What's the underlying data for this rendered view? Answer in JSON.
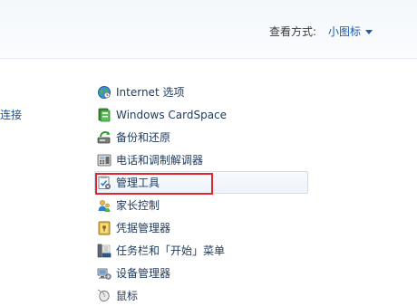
{
  "header": {
    "view_by_label": "查看方式:",
    "view_mode": "小图标"
  },
  "left_column": {
    "partial_label": "连接"
  },
  "items": [
    {
      "label": "Internet 选项",
      "icon": "internet-options-icon"
    },
    {
      "label": "Windows CardSpace",
      "icon": "cardspace-icon"
    },
    {
      "label": "备份和还原",
      "icon": "backup-restore-icon"
    },
    {
      "label": "电话和调制解调器",
      "icon": "phone-modem-icon"
    },
    {
      "label": "管理工具",
      "icon": "admin-tools-icon"
    },
    {
      "label": "家长控制",
      "icon": "parental-controls-icon"
    },
    {
      "label": "凭据管理器",
      "icon": "credential-manager-icon"
    },
    {
      "label": "任务栏和「开始」菜单",
      "icon": "taskbar-start-menu-icon"
    },
    {
      "label": "设备管理器",
      "icon": "device-manager-icon"
    },
    {
      "label": "鼠标",
      "icon": "mouse-icon"
    }
  ],
  "colors": {
    "link": "#1e5aa8",
    "item_text": "#1e395b",
    "highlight_border": "#e0262e"
  }
}
